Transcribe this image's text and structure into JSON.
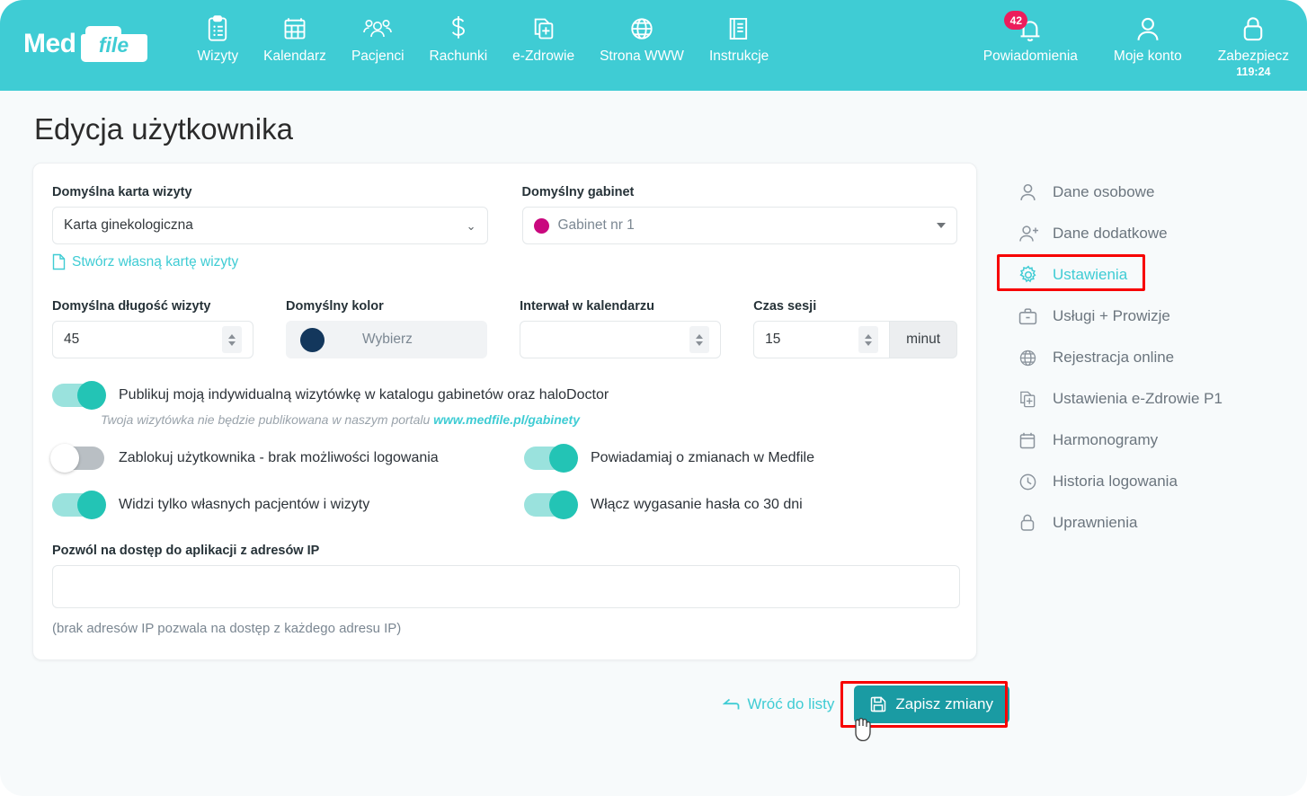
{
  "header": {
    "logo": {
      "part1": "Med",
      "part2": "file"
    },
    "nav": [
      {
        "label": "Wizyty",
        "icon": "clipboard-icon"
      },
      {
        "label": "Kalendarz",
        "icon": "calendar-icon"
      },
      {
        "label": "Pacjenci",
        "icon": "people-icon"
      },
      {
        "label": "Rachunki",
        "icon": "dollar-icon"
      },
      {
        "label": "e-Zdrowie",
        "icon": "medical-docs-icon"
      },
      {
        "label": "Strona WWW",
        "icon": "globe-icon"
      },
      {
        "label": "Instrukcje",
        "icon": "book-icon"
      }
    ],
    "right": [
      {
        "label": "Powiadomienia",
        "icon": "bell-icon",
        "badge": "42"
      },
      {
        "label": "Moje konto",
        "icon": "user-icon"
      },
      {
        "label": "Zabezpiecz",
        "icon": "lock-icon",
        "timer": "119:24"
      }
    ]
  },
  "page": {
    "title": "Edycja użytkownika"
  },
  "form": {
    "default_card": {
      "label": "Domyślna karta wizyty",
      "value": "Karta ginekologiczna",
      "create_link": "Stwórz własną kartę wizyty"
    },
    "default_office": {
      "label": "Domyślny gabinet",
      "value": "Gabinet nr 1",
      "dot_color": "#c9087e"
    },
    "default_length": {
      "label": "Domyślna długość wizyty",
      "value": "45"
    },
    "default_color": {
      "label": "Domyślny kolor",
      "button_label": "Wybierz",
      "swatch_color": "#13375c"
    },
    "calendar_interval": {
      "label": "Interwał w kalendarzu",
      "value": ""
    },
    "session_time": {
      "label": "Czas sesji",
      "value": "15",
      "unit": "minut"
    },
    "toggles": [
      {
        "label": "Publikuj moją indywidualną wizytówkę w katalogu gabinetów oraz haloDoctor",
        "state": "on"
      },
      {
        "label": "Zablokuj użytkownika - brak możliwości logowania",
        "state": "off"
      },
      {
        "label": "Powiadamiaj o zmianach w Medfile",
        "state": "on"
      },
      {
        "label": "Widzi tylko własnych pacjentów i wizyty",
        "state": "on"
      },
      {
        "label": "Włącz wygasanie hasła co 30 dni",
        "state": "on"
      }
    ],
    "publish_hint": {
      "text": "Twoja wizytówka nie będzie publikowana w naszym portalu",
      "link": "www.medfile.pl/gabinety"
    },
    "ip_access": {
      "label": "Pozwól na dostęp do aplikacji z adresów IP",
      "value": "",
      "note": "(brak adresów IP pozwala na dostęp z każdego adresu IP)"
    }
  },
  "sidebar": {
    "items": [
      {
        "label": "Dane osobowe",
        "icon": "user-icon",
        "active": false
      },
      {
        "label": "Dane dodatkowe",
        "icon": "user-plus-icon",
        "active": false
      },
      {
        "label": "Ustawienia",
        "icon": "gear-icon",
        "active": true
      },
      {
        "label": "Usługi + Prowizje",
        "icon": "briefcase-icon",
        "active": false
      },
      {
        "label": "Rejestracja online",
        "icon": "globe-icon",
        "active": false
      },
      {
        "label": "Ustawienia e-Zdrowie P1",
        "icon": "medical-docs-icon",
        "active": false
      },
      {
        "label": "Harmonogramy",
        "icon": "calendar-icon",
        "active": false
      },
      {
        "label": "Historia logowania",
        "icon": "clock-icon",
        "active": false
      },
      {
        "label": "Uprawnienia",
        "icon": "lock-icon",
        "active": false
      }
    ]
  },
  "actions": {
    "back_label": "Wróć do listy",
    "save_label": "Zapisz zmiany"
  },
  "colors": {
    "brand_teal": "#3fccd4",
    "save_button": "#1a9ba3",
    "badge_pink": "#ec1d5c",
    "highlight_red": "#f70000"
  }
}
